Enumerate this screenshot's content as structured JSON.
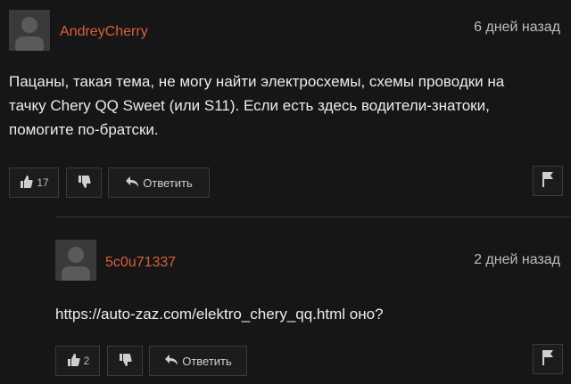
{
  "comments": [
    {
      "username": "AndreyCherry",
      "time": "6 дней назад",
      "text": "Пацаны, такая тема, не могу найти электросхемы, схемы проводки на тачку Chery QQ Sweet (или S11). Если есть здесь водители-знатоки, помогите по-братски.",
      "likes": "17",
      "reply_label": "Ответить"
    },
    {
      "username": "5c0u71337",
      "time": "2 дней назад",
      "text": "https://auto-zaz.com/elektro_chery_qq.html оно?",
      "likes": "2",
      "reply_label": "Ответить"
    }
  ],
  "colors": {
    "username": "#d9603b",
    "background": "#161616"
  },
  "icons": [
    "avatar-icon",
    "thumbs-up-icon",
    "thumbs-down-icon",
    "reply-arrow-icon",
    "flag-icon"
  ]
}
